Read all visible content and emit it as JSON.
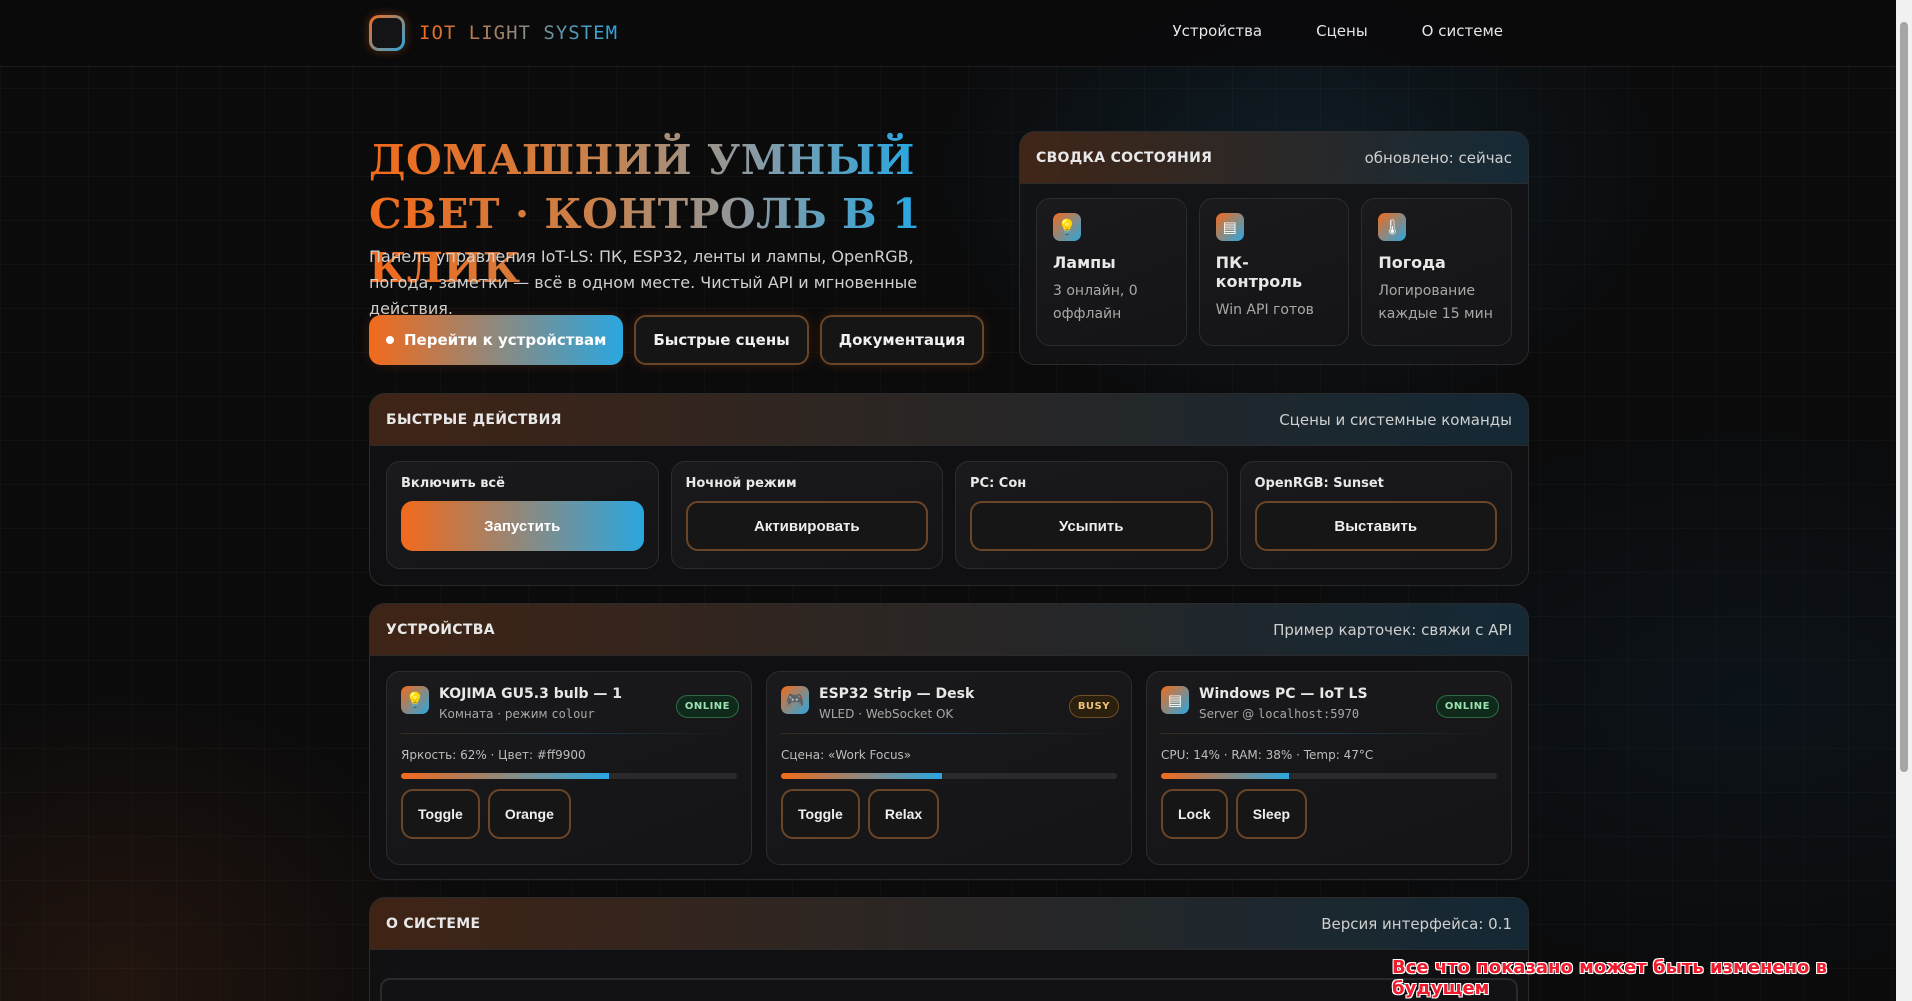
{
  "brand": {
    "name": "IOT LIGHT SYSTEM"
  },
  "nav": {
    "devices": "Устройства",
    "scenes": "Сцены",
    "about": "О системе"
  },
  "hero": {
    "title": "ДОМАШНИЙ УМНЫЙ СВЕТ · КОНТРОЛЬ В 1 КЛИК",
    "description": "Панель управления IoT-LS: ПК, ESP32, ленты и лампы, OpenRGB, погода, заметки — всё в одном месте. Чистый API и мгновенные действия.",
    "btn_devices": "Перейти к устройствам",
    "btn_scenes": "Быстрые сцены",
    "btn_docs": "Документация"
  },
  "summary": {
    "title": "СВОДКА СОСТОЯНИЯ",
    "updated": "обновлено: сейчас",
    "cards": [
      {
        "icon": "lightbulb-icon",
        "name": "Лампы",
        "desc": "3 онлайн, 0 оффлайн"
      },
      {
        "icon": "monitor-icon",
        "name": "ПК-контроль",
        "desc": "Win API готов"
      },
      {
        "icon": "thermometer-icon",
        "name": "Погода",
        "desc": "Логирование каждые 15 мин"
      }
    ]
  },
  "quick_actions": {
    "title": "БЫСТРЫЕ ДЕЙСТВИЯ",
    "subtitle": "Сцены и системные команды",
    "items": [
      {
        "name": "Включить всё",
        "button": "Запустить"
      },
      {
        "name": "Ночной режим",
        "button": "Активировать"
      },
      {
        "name": "PC: Сон",
        "button": "Усыпить"
      },
      {
        "name": "OpenRGB: Sunset",
        "button": "Выставить"
      }
    ]
  },
  "devices": {
    "title": "УСТРОЙСТВА",
    "subtitle": "Пример карточек: свяжи с API",
    "items": [
      {
        "icon": "lightbulb-icon",
        "name": "KOJIMA GU5.3 bulb — 1",
        "sub_prefix": "Комната · режим ",
        "sub_code": "colour",
        "status": "ONLINE",
        "meta": "Яркость: 62% · Цвет: #ff9900",
        "progress": 62,
        "btn1": "Toggle",
        "btn2": "Orange"
      },
      {
        "icon": "joystick-icon",
        "name": "ESP32 Strip — Desk",
        "sub_prefix": "WLED · WebSocket OK",
        "sub_code": "",
        "status": "BUSY",
        "meta": "Сцена: «Work Focus»",
        "progress": 48,
        "btn1": "Toggle",
        "btn2": "Relax"
      },
      {
        "icon": "monitor-icon",
        "name": "Windows PC — IoT LS",
        "sub_prefix": "Server @ ",
        "sub_code": "localhost:5970",
        "status": "ONLINE",
        "meta": "CPU: 14% · RAM: 38% · Temp: 47°C",
        "progress": 38,
        "btn1": "Lock",
        "btn2": "Sleep"
      }
    ]
  },
  "about": {
    "title": "О СИСТЕМЕ",
    "version": "Версия интерфейса: 0.1"
  },
  "watermark": "Все что показано может быть изменено в будущем",
  "colors": {
    "accent_orange": "#f26a1b",
    "accent_blue": "#2aa7e0",
    "online": "#9be3b0",
    "busy": "#f0c37a"
  }
}
